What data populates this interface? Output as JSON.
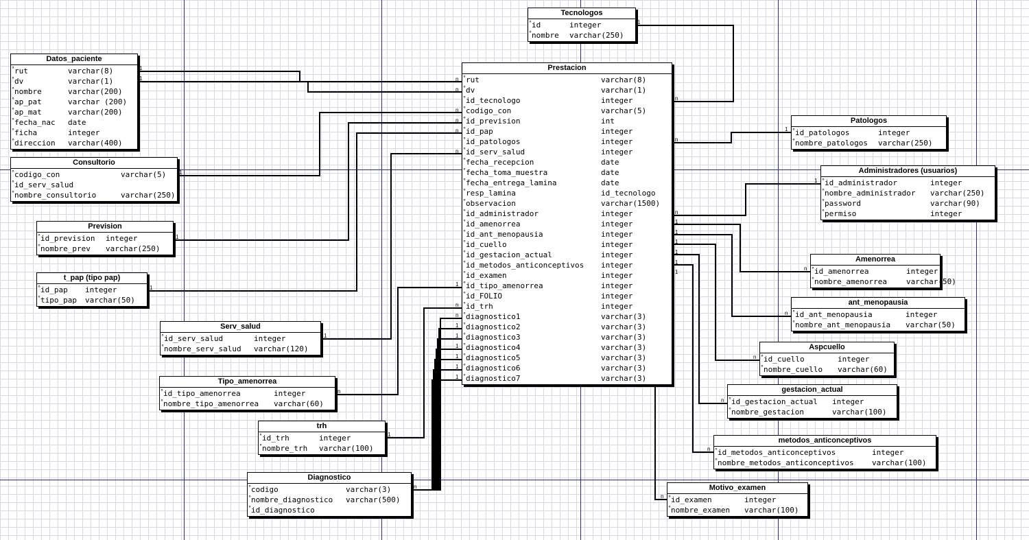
{
  "entities": {
    "tecnologos": {
      "title": "Tecnologos",
      "rows": [
        {
          "name": "id",
          "type": "integer"
        },
        {
          "name": "nombre",
          "type": "varchar(250)"
        }
      ]
    },
    "datos_paciente": {
      "title": "Datos_paciente",
      "rows": [
        {
          "name": "rut",
          "type": "varchar(8)"
        },
        {
          "name": "dv",
          "type": "varchar(1)"
        },
        {
          "name": "nombre",
          "type": "varchar(200)"
        },
        {
          "name": "ap_pat",
          "type": "varchar (200)"
        },
        {
          "name": "ap_mat",
          "type": "varchar(200)"
        },
        {
          "name": "fecha_nac",
          "type": "date"
        },
        {
          "name": "ficha",
          "type": "integer"
        },
        {
          "name": "direccion",
          "type": "varchar(400)"
        }
      ]
    },
    "consultorio": {
      "title": "Consultorio",
      "rows": [
        {
          "name": "codigo_con",
          "type": "varchar(5)"
        },
        {
          "name": "id_serv_salud",
          "type": ""
        },
        {
          "name": "nombre_consultorio",
          "type": "varchar(250)"
        }
      ]
    },
    "prevision": {
      "title": "Prevision",
      "rows": [
        {
          "name": "id_prevision",
          "type": "integer"
        },
        {
          "name": "nombre_prev",
          "type": "varchar(250)"
        }
      ]
    },
    "t_pap": {
      "title": "t_pap (tipo pap)",
      "rows": [
        {
          "name": "id_pap",
          "type": "integer"
        },
        {
          "name": "tipo_pap",
          "type": "varchar(50)"
        }
      ]
    },
    "serv_salud": {
      "title": "Serv_salud",
      "rows": [
        {
          "name": "id_serv_salud",
          "type": "integer"
        },
        {
          "name": "nombre_serv_salud",
          "type": "varchar(120)"
        }
      ]
    },
    "tipo_amenorrea": {
      "title": "Tipo_amenorrea",
      "rows": [
        {
          "name": "id_tipo_amenorrea",
          "type": "integer"
        },
        {
          "name": "nombre_tipo_amenorrea",
          "type": "varchar(60)"
        }
      ]
    },
    "trh": {
      "title": "trh",
      "rows": [
        {
          "name": "id_trh",
          "type": "integer"
        },
        {
          "name": "nombre_trh",
          "type": "varchar(100)"
        }
      ]
    },
    "diagnostico": {
      "title": "Diagnostico",
      "rows": [
        {
          "name": "codigo",
          "type": "varchar(3)"
        },
        {
          "name": "nombre_diagnostico",
          "type": "varchar(500)"
        },
        {
          "name": "id_diagnostico",
          "type": ""
        }
      ]
    },
    "prestacion": {
      "title": "Prestacion",
      "rows": [
        {
          "name": "rut",
          "type": "varchar(8)"
        },
        {
          "name": "dv",
          "type": "varchar(1)"
        },
        {
          "name": "id_tecnologo",
          "type": "integer"
        },
        {
          "name": "codigo_con",
          "type": "varchar(5)"
        },
        {
          "name": "id_prevision",
          "type": "int"
        },
        {
          "name": "id_pap",
          "type": "integer"
        },
        {
          "name": "id_patologos",
          "type": "integer"
        },
        {
          "name": "id_serv_salud",
          "type": "integer"
        },
        {
          "name": "fecha_recepcion",
          "type": "date"
        },
        {
          "name": "fecha_toma_muestra",
          "type": "date"
        },
        {
          "name": "fecha_entrega_lamina",
          "type": "date"
        },
        {
          "name": "resp_lamina",
          "type": "id_tecnologo"
        },
        {
          "name": "observacion",
          "type": "varchar(1500)"
        },
        {
          "name": "id_administrador",
          "type": "integer"
        },
        {
          "name": "id_amenorrea",
          "type": "integer"
        },
        {
          "name": "id_ant_menopausia",
          "type": "integer"
        },
        {
          "name": "id_cuello",
          "type": "integer"
        },
        {
          "name": "id_gestacion_actual",
          "type": "integer"
        },
        {
          "name": "id_metodos_anticonceptivos",
          "type": "integer"
        },
        {
          "name": "id_examen",
          "type": "integer"
        },
        {
          "name": "id_tipo_amenorrea",
          "type": "integer"
        },
        {
          "name": "id_FOLIO",
          "type": "integer"
        },
        {
          "name": "id_trh",
          "type": "integer"
        },
        {
          "name": "diagnostico1",
          "type": "varchar(3)"
        },
        {
          "name": "diagnostico2",
          "type": "varchar(3)"
        },
        {
          "name": "diagnostico3",
          "type": "varchar(3)"
        },
        {
          "name": "diagnostico4",
          "type": "varchar(3)"
        },
        {
          "name": "diagnostico5",
          "type": "varchar(3)"
        },
        {
          "name": "diagnostico6",
          "type": "varchar(3)"
        },
        {
          "name": "diagnostico7",
          "type": "varchar(3)"
        }
      ]
    },
    "patologos": {
      "title": "Patologos",
      "rows": [
        {
          "name": "id_patologos",
          "type": "integer"
        },
        {
          "name": "nombre_patologos",
          "type": "varchar(250)"
        }
      ]
    },
    "administradores": {
      "title": "Administradores (usuarios)",
      "rows": [
        {
          "name": "id_administrador",
          "type": "integer"
        },
        {
          "name": "nombre_administrador",
          "type": "varchar(250)"
        },
        {
          "name": "password",
          "type": "varchar(90)"
        },
        {
          "name": "permiso",
          "type": "integer"
        }
      ]
    },
    "amenorrea": {
      "title": "Amenorrea",
      "rows": [
        {
          "name": "id_amenorrea",
          "type": "integer"
        },
        {
          "name": "nombre_amenorrea",
          "type": "varchar(50)"
        }
      ]
    },
    "ant_menopausia": {
      "title": "ant_menopausia",
      "rows": [
        {
          "name": "id_ant_menopausia",
          "type": "integer"
        },
        {
          "name": "nombre_ant_menopausia",
          "type": "varchar(50)"
        }
      ]
    },
    "aspcuello": {
      "title": "Aspcuello",
      "rows": [
        {
          "name": "id_cuello",
          "type": "integer"
        },
        {
          "name": "nombre_cuello",
          "type": "varchar(60)"
        }
      ]
    },
    "gestacion_actual": {
      "title": "gestacion_actual",
      "rows": [
        {
          "name": "id_gestacion_actual",
          "type": "integer"
        },
        {
          "name": "nombre_gestacion",
          "type": "varchar(100)"
        }
      ]
    },
    "metodos_anticonceptivos": {
      "title": "metodos_anticonceptivos",
      "rows": [
        {
          "name": "id_metodos_anticonceptivos",
          "type": "integer"
        },
        {
          "name": "nombre_metodos_anticonceptivos",
          "type": "varchar(100)"
        }
      ]
    },
    "motivo_examen": {
      "title": "Motivo_examen",
      "rows": [
        {
          "name": "id_examen",
          "type": "integer"
        },
        {
          "name": "nombre_examen",
          "type": "varchar(100)"
        }
      ]
    }
  },
  "cardinality": {
    "one": "1",
    "many": "n"
  }
}
